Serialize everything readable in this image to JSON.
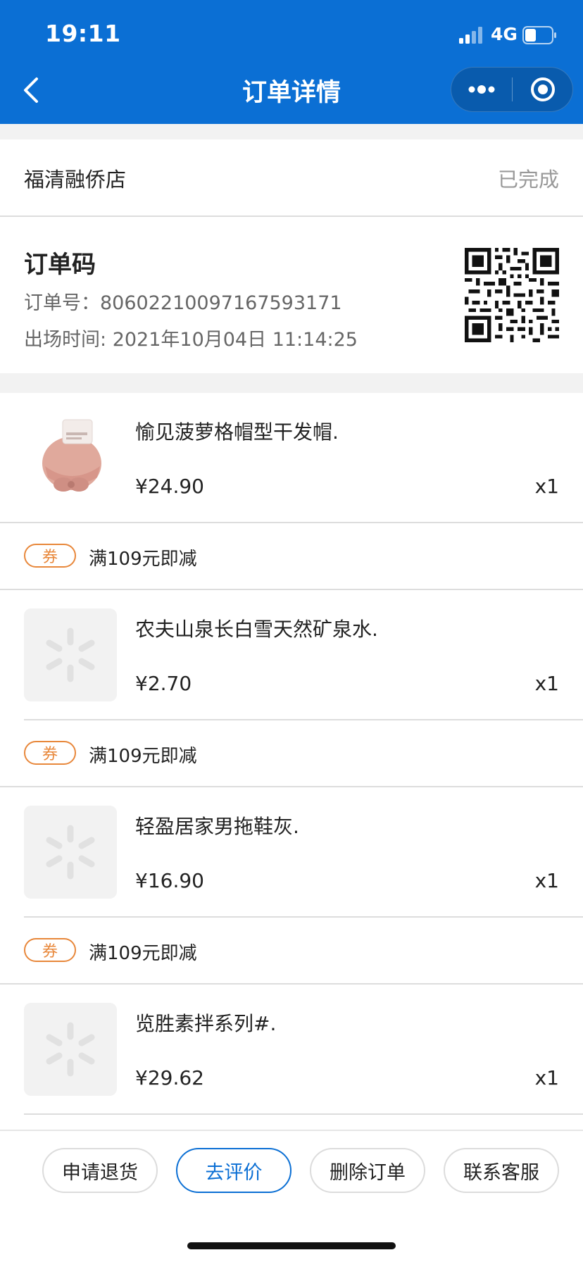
{
  "status_bar": {
    "time": "19:11",
    "network": "4G"
  },
  "nav": {
    "title": "订单详情",
    "back_icon": "chevron-left-icon",
    "more_icon": "more-dots-icon",
    "close_icon": "target-circle-icon"
  },
  "store": {
    "name": "福清融侨店",
    "status": "已完成"
  },
  "order": {
    "code_title": "订单码",
    "order_no_label": "订单号：",
    "order_no": "80602210097167593171",
    "exit_time_label": "出场时间: ",
    "exit_time": "2021年10月04日 11:14:25"
  },
  "items": [
    {
      "name": "愉见菠萝格帽型干发帽.",
      "price": "¥24.90",
      "qty": "x1",
      "image": "pink-hair-cap"
    },
    {
      "name": "农夫山泉长白雪天然矿泉水.",
      "price": "¥2.70",
      "qty": "x1",
      "image": "placeholder-spark-icon"
    },
    {
      "name": "轻盈居家男拖鞋灰.",
      "price": "¥16.90",
      "qty": "x1",
      "image": "placeholder-spark-icon"
    },
    {
      "name": "览胜素拌系列#.",
      "price": "¥29.62",
      "qty": "x1",
      "image": "placeholder-spark-icon"
    }
  ],
  "coupons": [
    {
      "badge": "券",
      "text": "满109元即减"
    },
    {
      "badge": "券",
      "text": "满109元即减"
    },
    {
      "badge": "券",
      "text": "满109元即减"
    }
  ],
  "actions": {
    "refund": "申请退货",
    "review": "去评价",
    "delete": "删除订单",
    "service": "联系客服"
  },
  "colors": {
    "brand_blue": "#0b6fd4",
    "coupon_orange": "#e8873a",
    "muted_text": "#999999"
  }
}
